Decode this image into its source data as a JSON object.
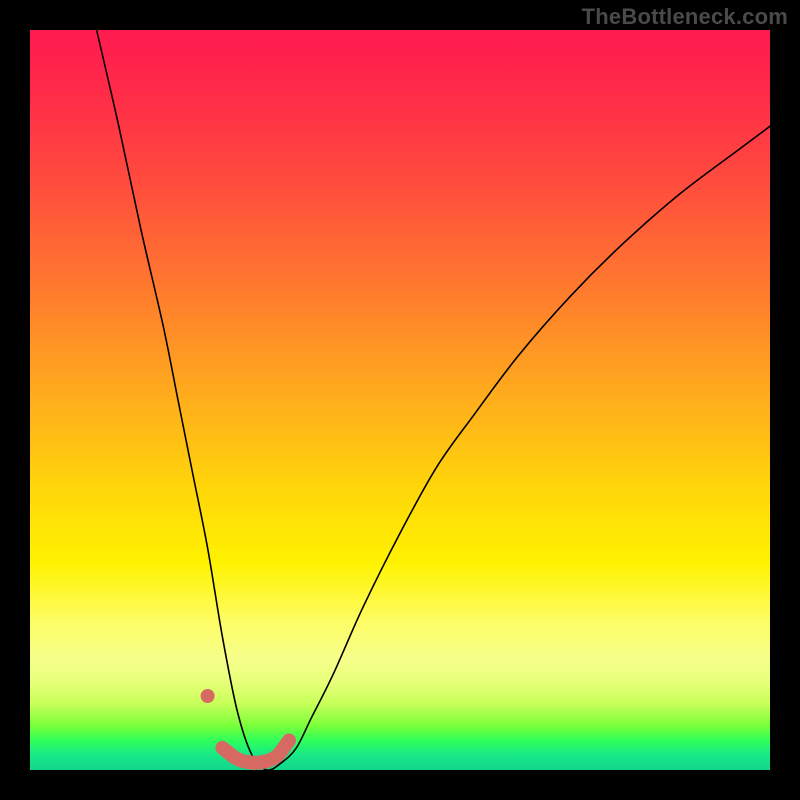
{
  "watermark": "TheBottleneck.com",
  "colors": {
    "background": "#000000",
    "gradient_top": "#ff1a4f",
    "gradient_mid1": "#ff7a2e",
    "gradient_mid2": "#ffd60a",
    "gradient_mid3": "#f6ff8a",
    "gradient_bottom": "#13d68b",
    "curve": "#000000",
    "marker": "#d66a63"
  },
  "chart_data": {
    "type": "line",
    "title": "",
    "xlabel": "",
    "ylabel": "",
    "xlim": [
      0,
      100
    ],
    "ylim": [
      0,
      100
    ],
    "grid": false,
    "legend": false,
    "description": "Bottleneck-style curve: y is high at both x extremes and drops to ~0 near the valley around x≈31. Left branch is steep; right branch rises more gradually. Pink marker highlights the valley floor between x≈26 and x≈35 plus a small isolated dot near x≈24.",
    "series": [
      {
        "name": "curve",
        "x": [
          9,
          12,
          15,
          18,
          20,
          22,
          24,
          26,
          28,
          30,
          32,
          34,
          36,
          38,
          41,
          45,
          50,
          55,
          60,
          66,
          73,
          80,
          88,
          96,
          100
        ],
        "y": [
          100,
          87,
          73,
          60,
          50,
          40,
          30,
          18,
          8,
          2,
          0,
          1,
          3,
          7,
          13,
          22,
          32,
          41,
          48,
          56,
          64,
          71,
          78,
          84,
          87
        ]
      }
    ],
    "annotations": {
      "valley_marker": {
        "point": {
          "x": 24,
          "y": 10
        },
        "segment_x": [
          26,
          28,
          30,
          32,
          33.5,
          35
        ],
        "segment_y": [
          3,
          1.5,
          1,
          1.2,
          2,
          4
        ]
      }
    }
  }
}
